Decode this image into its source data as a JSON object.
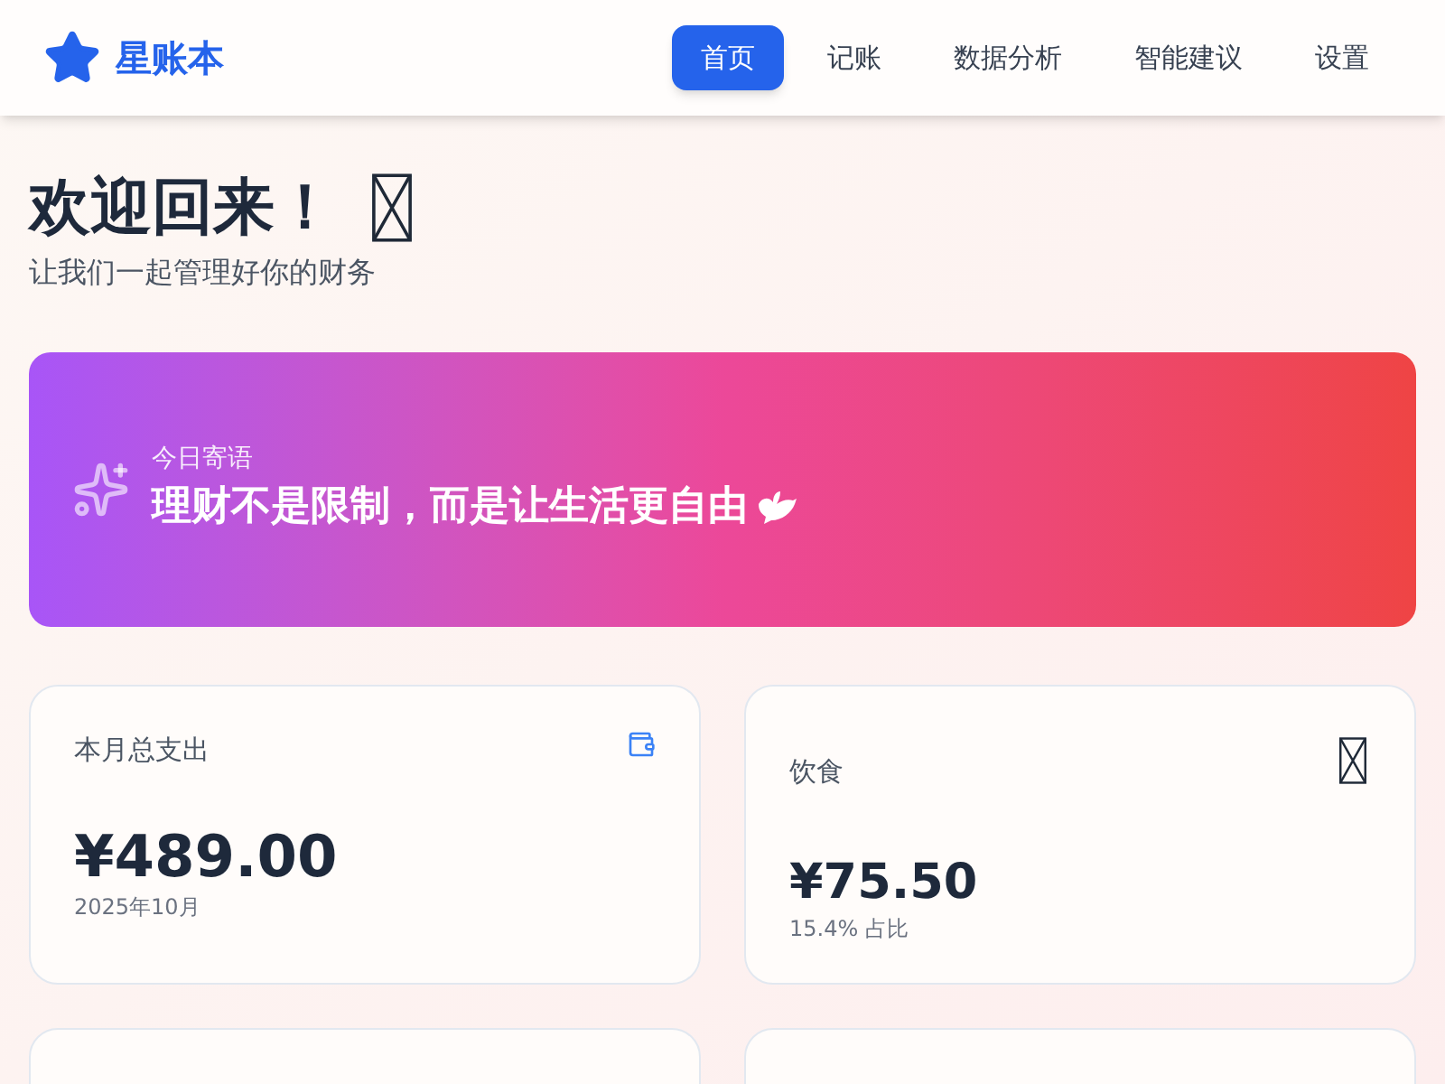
{
  "brand": {
    "name": "星账本"
  },
  "nav": [
    {
      "label": "首页",
      "selected": true
    },
    {
      "label": "记账",
      "selected": false
    },
    {
      "label": "数据分析",
      "selected": false
    },
    {
      "label": "智能建议",
      "selected": false
    },
    {
      "label": "设置",
      "selected": false
    }
  ],
  "welcome": {
    "title": "欢迎回来！",
    "subtitle": "让我们一起管理好你的财务"
  },
  "quote": {
    "label": "今日寄语",
    "text": "理财不是限制，而是让生活更自由"
  },
  "stats": [
    {
      "kind": "total",
      "label": "本月总支出",
      "amount": "¥489.00",
      "note": "2025年10月"
    },
    {
      "kind": "category",
      "label": "饮食",
      "amount": "¥75.50",
      "note": "15.4% 占比"
    }
  ]
}
